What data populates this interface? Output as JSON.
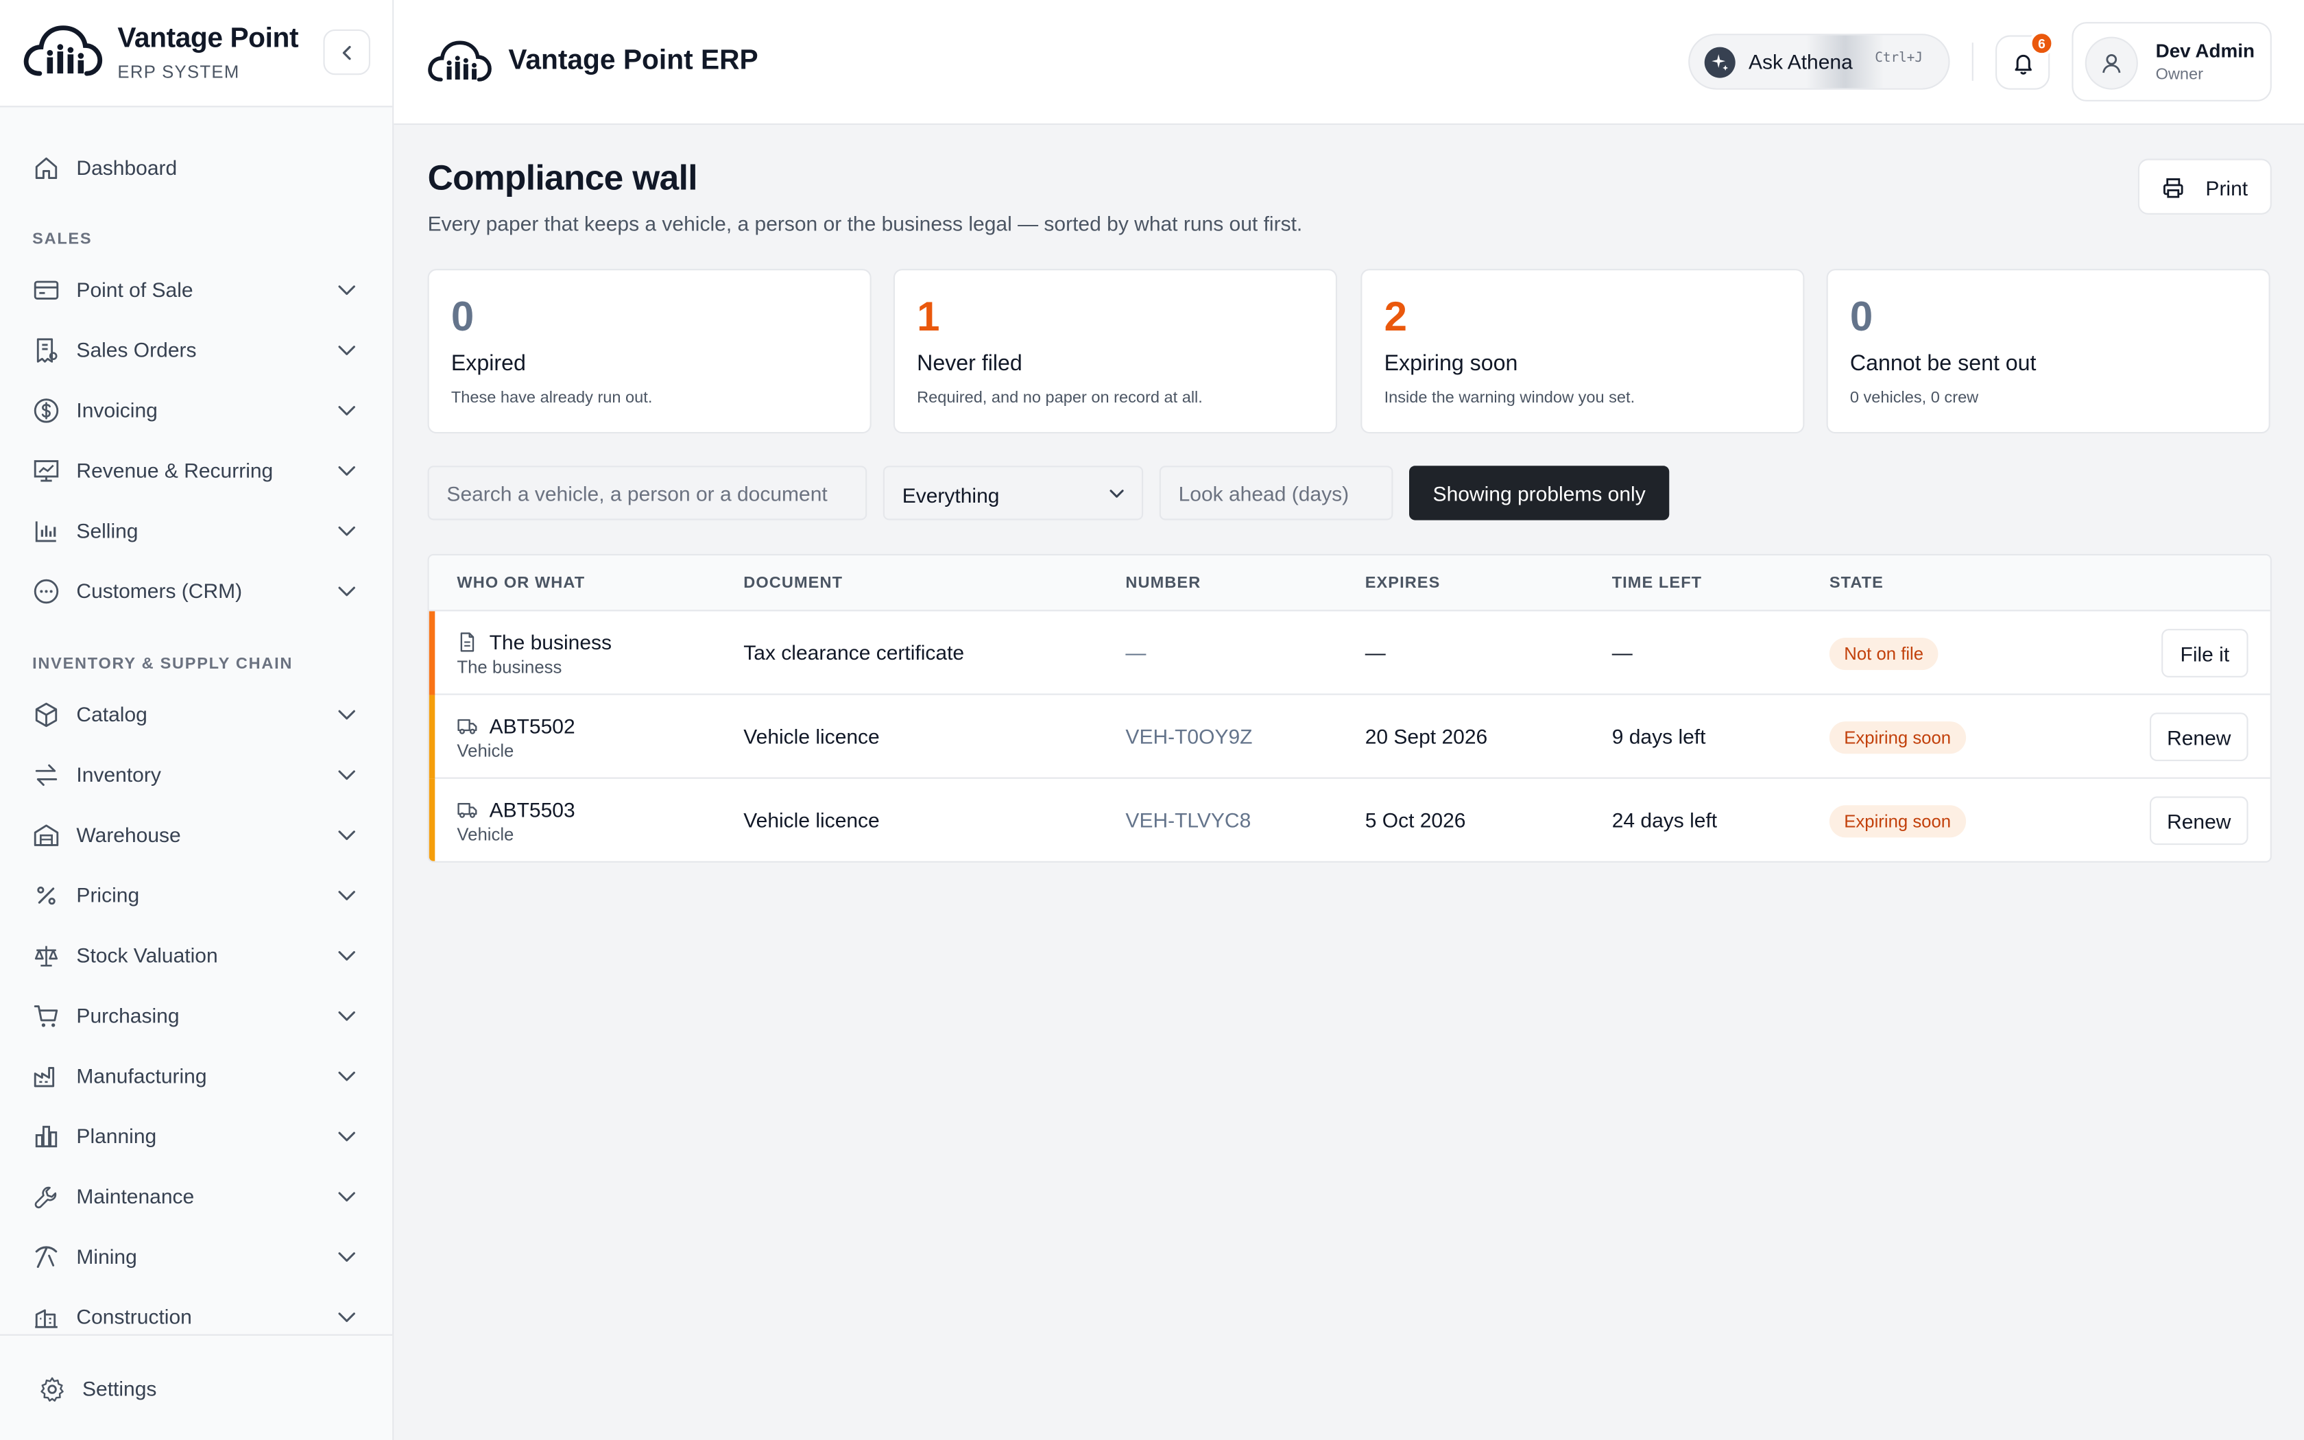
{
  "colors": {
    "accent": "#ea580c",
    "neutral_number": "#64748b",
    "dark_button": "#1f2329",
    "warning_badge_bg": "#fdefe3",
    "warning_badge_text": "#c2410c",
    "row_accent_red": "#f97316",
    "row_accent_amber": "#f59e0b"
  },
  "sidebar": {
    "brand_name": "Vantage Point",
    "brand_sub": "ERP SYSTEM",
    "dashboard": "Dashboard",
    "section_sales": "SALES",
    "sales_items": [
      {
        "label": "Point of Sale",
        "icon": "pos-terminal-icon"
      },
      {
        "label": "Sales Orders",
        "icon": "receipt-icon"
      },
      {
        "label": "Invoicing",
        "icon": "dollar-circle-icon"
      },
      {
        "label": "Revenue & Recurring",
        "icon": "presentation-chart-icon"
      },
      {
        "label": "Selling",
        "icon": "bar-chart-icon"
      },
      {
        "label": "Customers (CRM)",
        "icon": "chat-bubble-icon"
      }
    ],
    "section_inventory": "INVENTORY & SUPPLY CHAIN",
    "inventory_items": [
      {
        "label": "Catalog",
        "icon": "package-icon"
      },
      {
        "label": "Inventory",
        "icon": "arrows-transfer-icon"
      },
      {
        "label": "Warehouse",
        "icon": "warehouse-icon"
      },
      {
        "label": "Pricing",
        "icon": "percent-icon"
      },
      {
        "label": "Stock Valuation",
        "icon": "scale-icon"
      },
      {
        "label": "Purchasing",
        "icon": "cart-icon"
      },
      {
        "label": "Manufacturing",
        "icon": "factory-icon"
      },
      {
        "label": "Planning",
        "icon": "columns-chart-icon"
      },
      {
        "label": "Maintenance",
        "icon": "wrench-icon"
      },
      {
        "label": "Mining",
        "icon": "pickaxe-icon"
      },
      {
        "label": "Construction",
        "icon": "building-icon"
      }
    ],
    "settings": "Settings"
  },
  "topbar": {
    "title": "Vantage Point ERP",
    "ask_label": "Ask Athena",
    "ask_shortcut": "Ctrl+J",
    "notification_count": "6",
    "user_name": "Dev Admin",
    "user_role": "Owner"
  },
  "page": {
    "title": "Compliance wall",
    "subtitle": "Every paper that keeps a vehicle, a person or the business legal — sorted by what runs out first.",
    "print_label": "Print"
  },
  "summary_cards": [
    {
      "number": "0",
      "title": "Expired",
      "desc": "These have already run out.",
      "tone": "neutral"
    },
    {
      "number": "1",
      "title": "Never filed",
      "desc": "Required, and no paper on record at all.",
      "tone": "accent"
    },
    {
      "number": "2",
      "title": "Expiring soon",
      "desc": "Inside the warning window you set.",
      "tone": "accent"
    },
    {
      "number": "0",
      "title": "Cannot be sent out",
      "desc": "0 vehicles, 0 crew",
      "tone": "neutral"
    }
  ],
  "filters": {
    "search_placeholder": "Search a vehicle, a person or a document",
    "scope_value": "Everything",
    "lookahead_placeholder": "Look ahead (days)",
    "toggle_label": "Showing problems only"
  },
  "table": {
    "headers": [
      "WHO OR WHAT",
      "DOCUMENT",
      "NUMBER",
      "EXPIRES",
      "TIME LEFT",
      "STATE"
    ],
    "rows": [
      {
        "name": "The business",
        "type": "The business",
        "icon": "document-icon",
        "document": "Tax clearance certificate",
        "number": "—",
        "expires": "—",
        "time_left": "—",
        "state": "Not on file",
        "action": "File it",
        "accent": "red"
      },
      {
        "name": "ABT5502",
        "type": "Vehicle",
        "icon": "truck-icon",
        "document": "Vehicle licence",
        "number": "VEH-T0OY9Z",
        "expires": "20 Sept 2026",
        "time_left": "9 days left",
        "state": "Expiring soon",
        "action": "Renew",
        "accent": "amber"
      },
      {
        "name": "ABT5503",
        "type": "Vehicle",
        "icon": "truck-icon",
        "document": "Vehicle licence",
        "number": "VEH-TLVYC8",
        "expires": "5 Oct 2026",
        "time_left": "24 days left",
        "state": "Expiring soon",
        "action": "Renew",
        "accent": "amber"
      }
    ]
  }
}
